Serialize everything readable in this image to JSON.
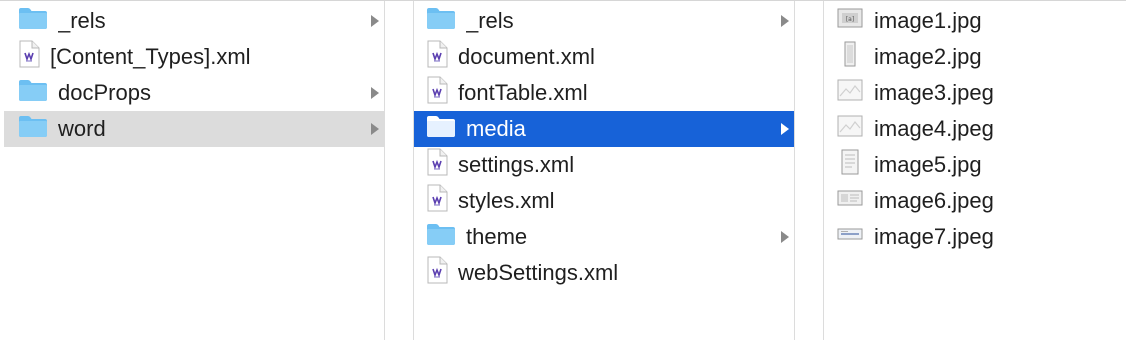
{
  "columns": [
    {
      "items": [
        {
          "label": "_rels",
          "type": "folder",
          "icon": "folder-icon",
          "has_children": true
        },
        {
          "label": "[Content_Types].xml",
          "type": "xml",
          "icon": "xml-file-icon",
          "has_children": false
        },
        {
          "label": "docProps",
          "type": "folder",
          "icon": "folder-icon",
          "has_children": true
        },
        {
          "label": "word",
          "type": "folder",
          "icon": "folder-icon",
          "has_children": true,
          "selected": "inactive"
        }
      ]
    },
    {
      "items": [
        {
          "label": "_rels",
          "type": "folder",
          "icon": "folder-icon",
          "has_children": true
        },
        {
          "label": "document.xml",
          "type": "xml",
          "icon": "xml-file-icon",
          "has_children": false
        },
        {
          "label": "fontTable.xml",
          "type": "xml",
          "icon": "xml-file-icon",
          "has_children": false
        },
        {
          "label": "media",
          "type": "folder",
          "icon": "folder-icon",
          "has_children": true,
          "selected": "active"
        },
        {
          "label": "settings.xml",
          "type": "xml",
          "icon": "xml-file-icon",
          "has_children": false
        },
        {
          "label": "styles.xml",
          "type": "xml",
          "icon": "xml-file-icon",
          "has_children": false
        },
        {
          "label": "theme",
          "type": "folder",
          "icon": "folder-icon",
          "has_children": true
        },
        {
          "label": "webSettings.xml",
          "type": "xml",
          "icon": "xml-file-icon",
          "has_children": false
        }
      ]
    },
    {
      "items": [
        {
          "label": "image1.jpg",
          "type": "image",
          "icon": "image-thumbnail-icon"
        },
        {
          "label": "image2.jpg",
          "type": "image",
          "icon": "image-thumbnail-icon"
        },
        {
          "label": "image3.jpeg",
          "type": "image",
          "icon": "image-thumbnail-icon"
        },
        {
          "label": "image4.jpeg",
          "type": "image",
          "icon": "image-thumbnail-icon"
        },
        {
          "label": "image5.jpg",
          "type": "image",
          "icon": "image-thumbnail-icon"
        },
        {
          "label": "image6.jpeg",
          "type": "image",
          "icon": "image-thumbnail-icon"
        },
        {
          "label": "image7.jpeg",
          "type": "image",
          "icon": "image-thumbnail-icon"
        }
      ]
    }
  ],
  "colors": {
    "folder": "#6cbff2",
    "folder_tab": "#86cdf6",
    "selection_active": "#1762d8",
    "selection_inactive": "#dcdcdc",
    "chevron": "#8a8a8a"
  }
}
